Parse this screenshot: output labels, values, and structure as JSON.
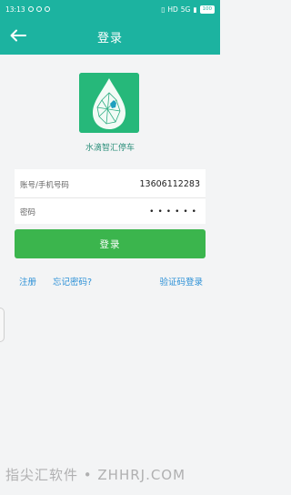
{
  "status_bar": {
    "time": "13:13",
    "network": "HD",
    "signal": "5G",
    "battery": "100"
  },
  "header": {
    "title": "登录"
  },
  "app": {
    "name": "水滴智汇停车"
  },
  "form": {
    "account_label": "账号/手机号码",
    "account_value": "13606112283",
    "password_label": "密码",
    "password_mask": "••••••"
  },
  "buttons": {
    "login": "登录"
  },
  "links": {
    "register": "注册",
    "forgot_password": "忘记密码?",
    "code_login": "验证码登录"
  },
  "watermark": {
    "text": "指尖汇软件 • ZHHRJ.COM"
  },
  "colors": {
    "header": "#1cb3a0",
    "button": "#3bb54d",
    "link": "#2a8fd6"
  }
}
